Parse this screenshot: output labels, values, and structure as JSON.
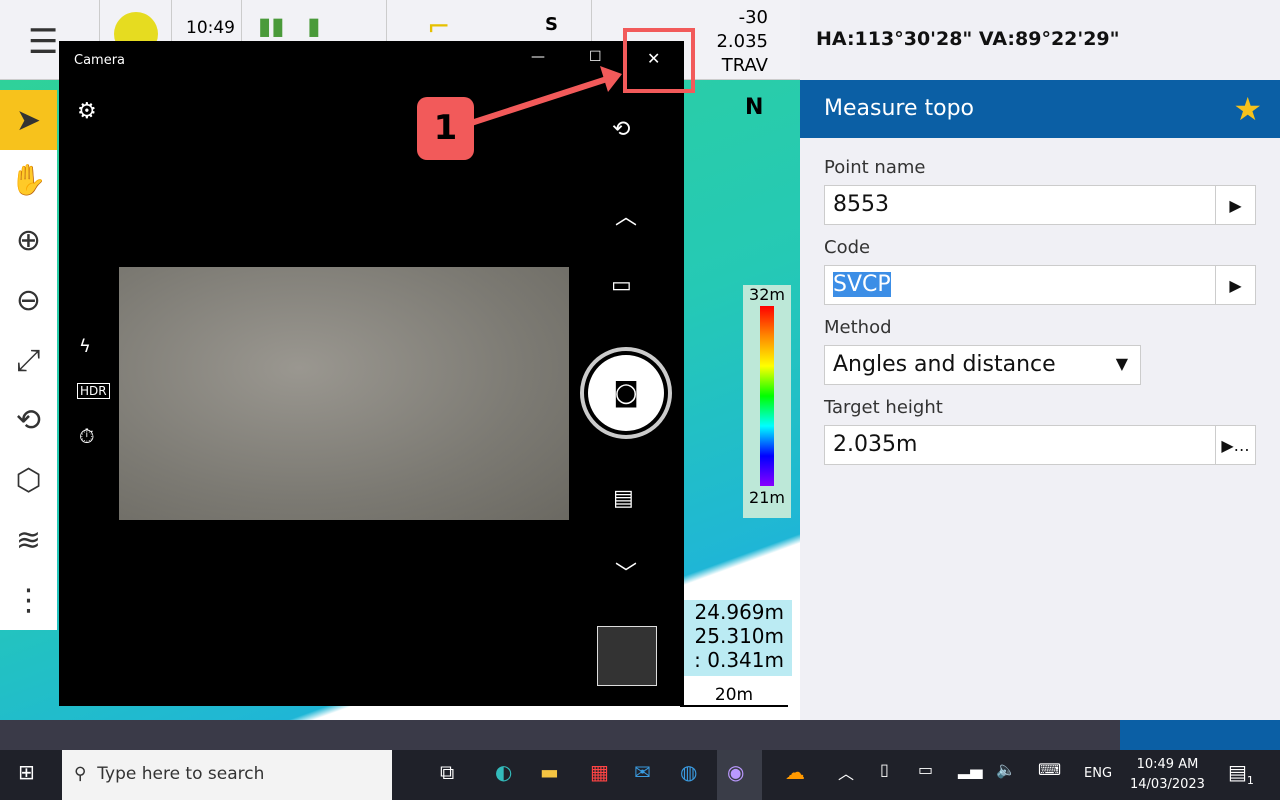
{
  "status": {
    "time": "10:49",
    "sat": "S",
    "offset": "-30",
    "height": "2.035",
    "mode": "TRAV"
  },
  "angles": "HA:113°30'28\"  VA:89°22'29\"",
  "camera": {
    "title": "Camera",
    "minimize": "—",
    "maximize": "☐",
    "close": "✕"
  },
  "annotation": {
    "step": "1",
    "color": "#f25a5a"
  },
  "map": {
    "north": "N",
    "scale_top": "32m",
    "scale_bottom": "21m",
    "d1": "24.969m",
    "d2": "25.310m",
    "d3": ": 0.341m",
    "scalebar": "20m"
  },
  "panel": {
    "title": "Measure topo",
    "fields": [
      {
        "label": "Point name",
        "value": "8553"
      },
      {
        "label": "Code",
        "value": "SVCP"
      },
      {
        "label": "Method",
        "value": "Angles and distance"
      },
      {
        "label": "Target height",
        "value": "2.035m"
      }
    ]
  },
  "taskbar": {
    "search_placeholder": "Type here to search",
    "lang": "ENG",
    "time": "10:49 AM",
    "date": "14/03/2023",
    "notifications": "1"
  },
  "colors": {
    "accent": "#0b5fa5",
    "selected_tool": "#f7c21c"
  }
}
